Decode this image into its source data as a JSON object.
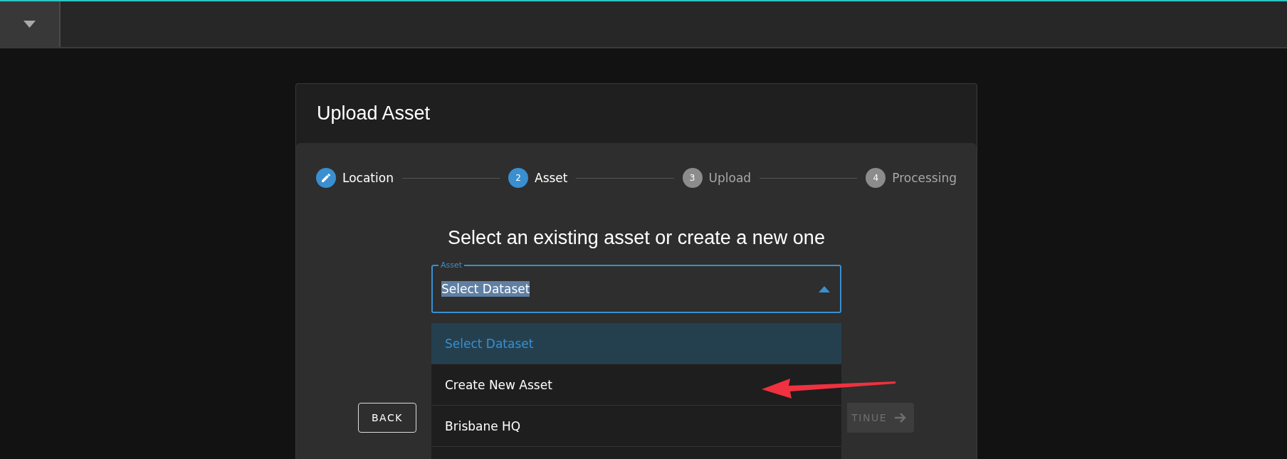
{
  "dialog": {
    "title": "Upload Asset",
    "steps": [
      {
        "label": "Location",
        "done": true,
        "active": false
      },
      {
        "label": "Asset",
        "number": "2",
        "done": false,
        "active": true
      },
      {
        "label": "Upload",
        "number": "3",
        "done": false,
        "active": false
      },
      {
        "label": "Processing",
        "number": "4",
        "done": false,
        "active": false
      }
    ],
    "heading": "Select an existing asset or create a new one",
    "field": {
      "label": "Asset",
      "value": "Select Dataset",
      "highlighted": true,
      "expanded": true
    },
    "menu": [
      {
        "label": "Select Dataset",
        "selected": true
      },
      {
        "label": "Create New Asset",
        "selected": false
      },
      {
        "label": "Brisbane HQ",
        "selected": false
      }
    ],
    "buttons": [
      {
        "label": "BACK",
        "kind": "outlined",
        "disabled": false
      },
      {
        "label": "TINUE",
        "kind": "filled",
        "disabled": true
      }
    ]
  }
}
